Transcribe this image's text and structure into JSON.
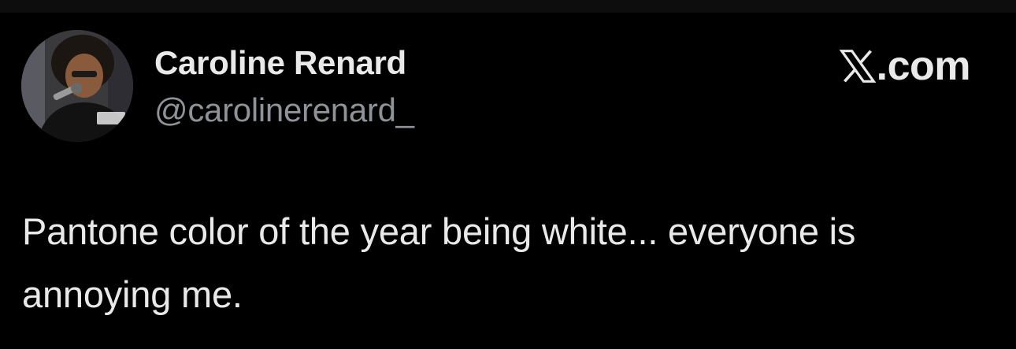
{
  "author": {
    "display_name": "Caroline Renard",
    "handle": "@carolinerenard_",
    "avatar_icon": "profile-photo-avatar"
  },
  "brand": {
    "logo_icon": "x-logo-icon",
    "domain_suffix": ".com"
  },
  "tweet": {
    "text": "Pantone color of the year being white... everyone is annoying me."
  },
  "colors": {
    "background": "#000000",
    "primary_text": "#e9e9e9",
    "secondary_text": "#8f9398"
  }
}
